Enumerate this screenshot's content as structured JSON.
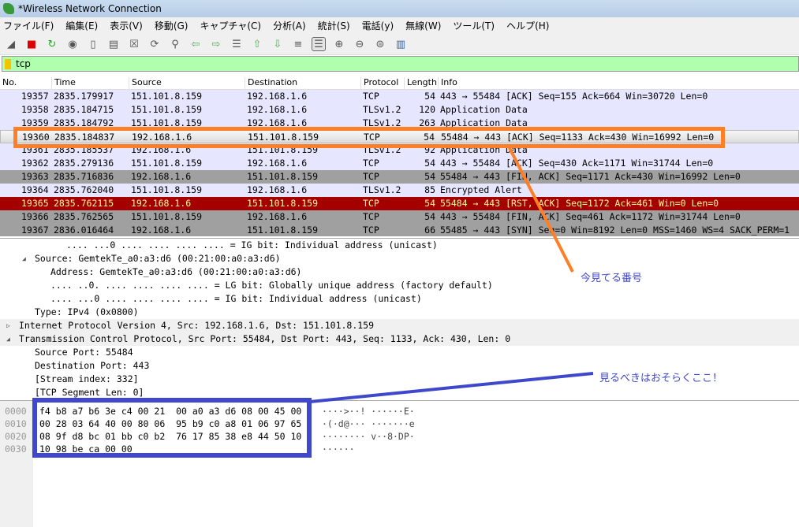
{
  "window": {
    "title": "*Wireless Network Connection"
  },
  "menu": [
    "ファイル(F)",
    "編集(E)",
    "表示(V)",
    "移動(G)",
    "キャプチャ(C)",
    "分析(A)",
    "統計(S)",
    "電話(y)",
    "無線(W)",
    "ツール(T)",
    "ヘルプ(H)"
  ],
  "toolbar_icons": [
    "shark-fin-start-icon",
    "stop-icon",
    "restart-icon",
    "options-gear-icon",
    "open-file-icon",
    "save-file-icon",
    "close-file-icon",
    "reload-icon",
    "find-icon",
    "back-arrow-icon",
    "forward-arrow-icon",
    "go-to-packet-icon",
    "first-packet-icon",
    "last-packet-icon",
    "autoscroll-icon",
    "colorize-icon",
    "zoom-in-icon",
    "zoom-out-icon",
    "normal-size-icon",
    "resize-columns-icon"
  ],
  "filter": {
    "value": "tcp"
  },
  "columns": [
    "No.",
    "Time",
    "Source",
    "Destination",
    "Protocol",
    "Length",
    "Info"
  ],
  "packets": [
    {
      "no": "19357",
      "time": "2835.179917",
      "src": "151.101.8.159",
      "dst": "192.168.1.6",
      "proto": "TCP",
      "len": "54",
      "info": "443 → 55484 [ACK] Seq=155 Ack=664 Win=30720 Len=0",
      "style": "normal"
    },
    {
      "no": "19358",
      "time": "2835.184715",
      "src": "151.101.8.159",
      "dst": "192.168.1.6",
      "proto": "TLSv1.2",
      "len": "120",
      "info": "Application Data",
      "style": "normal"
    },
    {
      "no": "19359",
      "time": "2835.184792",
      "src": "151.101.8.159",
      "dst": "192.168.1.6",
      "proto": "TLSv1.2",
      "len": "263",
      "info": "Application Data",
      "style": "normal"
    },
    {
      "no": "19360",
      "time": "2835.184837",
      "src": "192.168.1.6",
      "dst": "151.101.8.159",
      "proto": "TCP",
      "len": "54",
      "info": "55484 → 443 [ACK] Seq=1133 Ack=430 Win=16992 Len=0",
      "style": "sel"
    },
    {
      "no": "19361",
      "time": "2835.185537",
      "src": "192.168.1.6",
      "dst": "151.101.8.159",
      "proto": "TLSv1.2",
      "len": "92",
      "info": "Application Data",
      "style": "normal"
    },
    {
      "no": "19362",
      "time": "2835.279136",
      "src": "151.101.8.159",
      "dst": "192.168.1.6",
      "proto": "TCP",
      "len": "54",
      "info": "443 → 55484 [ACK] Seq=430 Ack=1171 Win=31744 Len=0",
      "style": "normal"
    },
    {
      "no": "19363",
      "time": "2835.716836",
      "src": "192.168.1.6",
      "dst": "151.101.8.159",
      "proto": "TCP",
      "len": "54",
      "info": "55484 → 443 [FIN, ACK] Seq=1171 Ack=430 Win=16992 Len=0",
      "style": "gray"
    },
    {
      "no": "19364",
      "time": "2835.762040",
      "src": "151.101.8.159",
      "dst": "192.168.1.6",
      "proto": "TLSv1.2",
      "len": "85",
      "info": "Encrypted Alert",
      "style": "normal"
    },
    {
      "no": "19365",
      "time": "2835.762115",
      "src": "192.168.1.6",
      "dst": "151.101.8.159",
      "proto": "TCP",
      "len": "54",
      "info": "55484 → 443 [RST, ACK] Seq=1172 Ack=461 Win=0 Len=0",
      "style": "red"
    },
    {
      "no": "19366",
      "time": "2835.762565",
      "src": "151.101.8.159",
      "dst": "192.168.1.6",
      "proto": "TCP",
      "len": "54",
      "info": "443 → 55484 [FIN, ACK] Seq=461 Ack=1172 Win=31744 Len=0",
      "style": "gray"
    },
    {
      "no": "19367",
      "time": "2836.016464",
      "src": "192.168.1.6",
      "dst": "151.101.8.159",
      "proto": "TCP",
      "len": "66",
      "info": "55485 → 443 [SYN] Seq=0 Win=8192 Len=0 MSS=1460 WS=4 SACK_PERM=1",
      "style": "gray"
    }
  ],
  "details": [
    {
      "indent": 3,
      "text": ".... ...0 .... .... .... .... = IG bit: Individual address (unicast)",
      "toggle": ""
    },
    {
      "indent": 1,
      "text": "Source: GemtekTe_a0:a3:d6 (00:21:00:a0:a3:d6)",
      "toggle": "◢"
    },
    {
      "indent": 2,
      "text": "Address: GemtekTe_a0:a3:d6 (00:21:00:a0:a3:d6)",
      "toggle": ""
    },
    {
      "indent": 2,
      "text": ".... ..0. .... .... .... .... = LG bit: Globally unique address (factory default)",
      "toggle": ""
    },
    {
      "indent": 2,
      "text": ".... ...0 .... .... .... .... = IG bit: Individual address (unicast)",
      "toggle": ""
    },
    {
      "indent": 1,
      "text": "Type: IPv4 (0x0800)",
      "toggle": ""
    },
    {
      "indent": 0,
      "text": "Internet Protocol Version 4, Src: 192.168.1.6, Dst: 151.101.8.159",
      "toggle": "▷"
    },
    {
      "indent": 0,
      "text": "Transmission Control Protocol, Src Port: 55484, Dst Port: 443, Seq: 1133, Ack: 430, Len: 0",
      "toggle": "◢"
    },
    {
      "indent": 1,
      "text": "Source Port: 55484",
      "toggle": ""
    },
    {
      "indent": 1,
      "text": "Destination Port: 443",
      "toggle": ""
    },
    {
      "indent": 1,
      "text": "[Stream index: 332]",
      "toggle": ""
    },
    {
      "indent": 1,
      "text": "[TCP Segment Len: 0]",
      "toggle": ""
    }
  ],
  "hex": [
    {
      "offset": "0000",
      "bytes": "f4 b8 a7 b6 3e c4 00 21  00 a0 a3 d6 08 00 45 00",
      "ascii": "····>··! ······E·"
    },
    {
      "offset": "0010",
      "bytes": "00 28 03 64 40 00 80 06  95 b9 c0 a8 01 06 97 65",
      "ascii": "·(·d@··· ·······e"
    },
    {
      "offset": "0020",
      "bytes": "08 9f d8 bc 01 bb c0 b2  76 17 85 38 e8 44 50 10",
      "ascii": "········ v··8·DP·"
    },
    {
      "offset": "0030",
      "bytes": "10 98 be ca 00 00",
      "ascii": "······"
    }
  ],
  "annotations": {
    "current_packet_note": "今見てる番号",
    "bytes_note": "見るべきはおそらくここ！",
    "orange": "#ff7f27",
    "blue": "#3f48cc"
  }
}
